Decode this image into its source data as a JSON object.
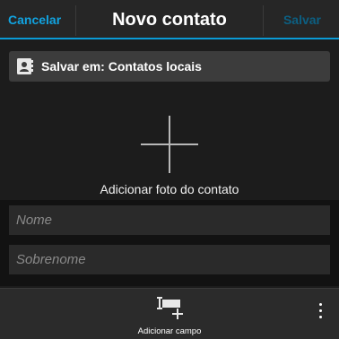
{
  "titlebar": {
    "cancel_label": "Cancelar",
    "title": "Novo contato",
    "save_label": "Salvar"
  },
  "save_in": {
    "label": "Salvar em: Contatos locais",
    "icon": "contact-book-icon"
  },
  "photo": {
    "label": "Adicionar foto do contato",
    "icon": "plus-icon"
  },
  "fields": {
    "first_name_placeholder": "Nome",
    "first_name_value": "",
    "last_name_placeholder": "Sobrenome",
    "last_name_value": ""
  },
  "bottombar": {
    "add_field_label": "Adicionar campo",
    "add_field_icon": "add-field-icon",
    "overflow_icon": "overflow-menu-icon"
  },
  "colors": {
    "accent": "#0a9bd6",
    "cancel": "#11a3e0",
    "save_disabled": "#0c5f82",
    "background": "#1c1c1c"
  }
}
